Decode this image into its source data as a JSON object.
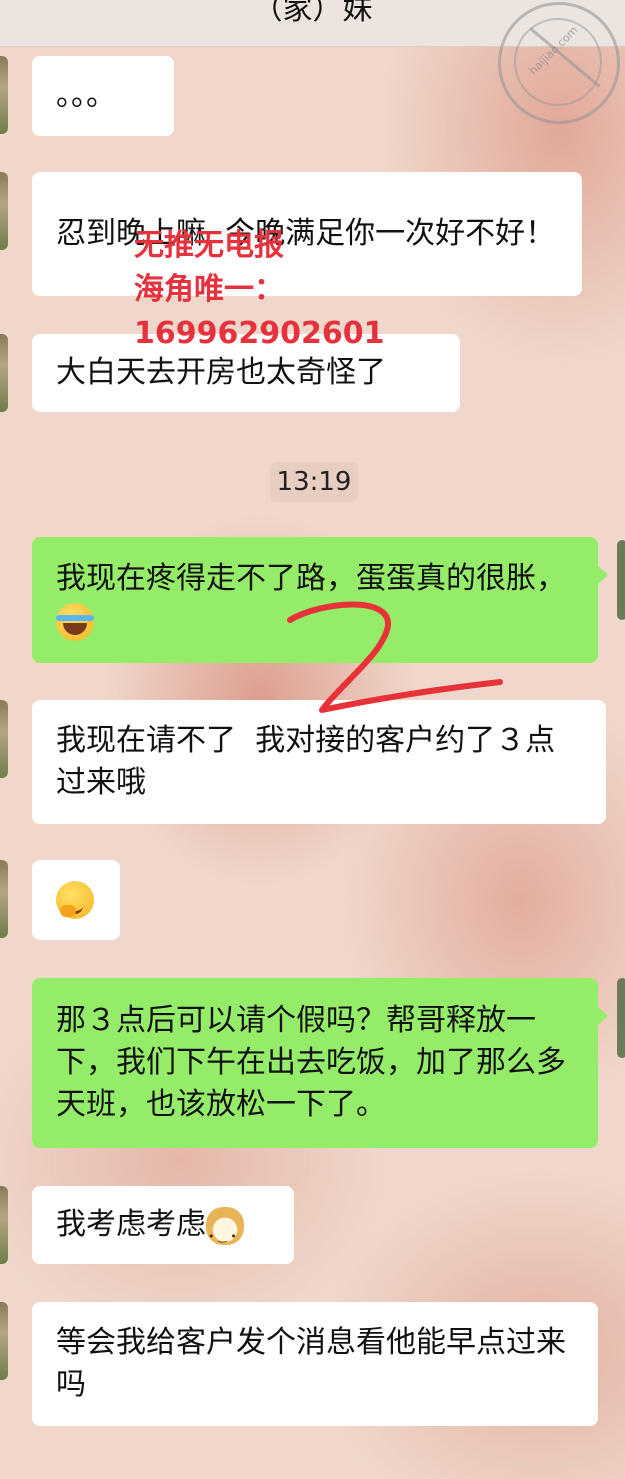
{
  "header": {
    "title": "（家）妹"
  },
  "watermark": {
    "line1": "无推无电报",
    "line2": "海角唯一：",
    "line3": "169962902601"
  },
  "stamp": {
    "text": "haijiao.com"
  },
  "messages": [
    {
      "side": "left",
      "text": "。。。"
    },
    {
      "side": "left",
      "text": "忍到晚上嘛  今晚满足你一次好不好！"
    },
    {
      "side": "left",
      "text": "大白天去开房也太奇怪了"
    },
    {
      "side": "time",
      "text": "13:19"
    },
    {
      "side": "right",
      "text": "我现在疼得走不了路，蛋蛋真的很胀，",
      "emoji": "crying-laughing-emoji"
    },
    {
      "side": "left",
      "text": "我现在请不了  我对接的客户约了３点过来哦"
    },
    {
      "side": "left",
      "text": "",
      "emoji": "thinking-face-emoji"
    },
    {
      "side": "right",
      "text": "那３点后可以请个假吗？帮哥释放一下，我们下午在出去吃饭，加了那么多天班，也该放松一下了。"
    },
    {
      "side": "left",
      "text": "我考虑考虑",
      "emoji": "doge-emoji"
    },
    {
      "side": "left",
      "text": "等会我给客户发个消息看他能早点过来吗"
    }
  ],
  "colors": {
    "green_bubble": "#95ec69",
    "white_bubble": "#ffffff",
    "watermark_red": "#e5323d",
    "scribble_red": "#e8323a"
  }
}
